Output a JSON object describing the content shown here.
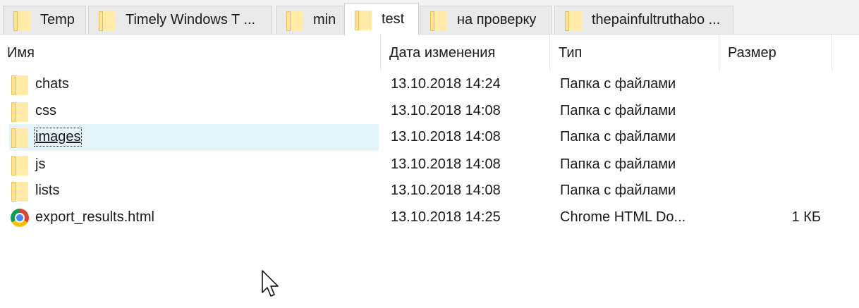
{
  "tabs": [
    {
      "label": "Temp",
      "active": false
    },
    {
      "label": "Timely Windows T ...",
      "active": false
    },
    {
      "label": "min",
      "active": false
    },
    {
      "label": "test",
      "active": true
    },
    {
      "label": "на проверку",
      "active": false
    },
    {
      "label": "thepainfultruthabo ...",
      "active": false
    }
  ],
  "columns": {
    "name": "Имя",
    "date": "Дата изменения",
    "type": "Тип",
    "size": "Размер"
  },
  "sort": {
    "column": "name",
    "direction": "ascending"
  },
  "files": [
    {
      "name": "chats",
      "date": "13.10.2018 14:24",
      "type": "Папка с файлами",
      "size": "",
      "icon": "folder-icon",
      "selected": false
    },
    {
      "name": "css",
      "date": "13.10.2018 14:08",
      "type": "Папка с файлами",
      "size": "",
      "icon": "folder-icon",
      "selected": false
    },
    {
      "name": "images",
      "date": "13.10.2018 14:08",
      "type": "Папка с файлами",
      "size": "",
      "icon": "folder-icon",
      "selected": true
    },
    {
      "name": "js",
      "date": "13.10.2018 14:08",
      "type": "Папка с файлами",
      "size": "",
      "icon": "folder-icon",
      "selected": false
    },
    {
      "name": "lists",
      "date": "13.10.2018 14:08",
      "type": "Папка с файлами",
      "size": "",
      "icon": "folder-icon",
      "selected": false
    },
    {
      "name": "export_results.html",
      "date": "13.10.2018 14:25",
      "type": "Chrome HTML Do...",
      "size": "1 КБ",
      "icon": "chrome-icon",
      "selected": false
    }
  ],
  "colors": {
    "selection": "#e5f3fb",
    "folder": "#fbe49a",
    "tab_inactive": "#e9e9e9",
    "tab_active": "#ffffff"
  }
}
